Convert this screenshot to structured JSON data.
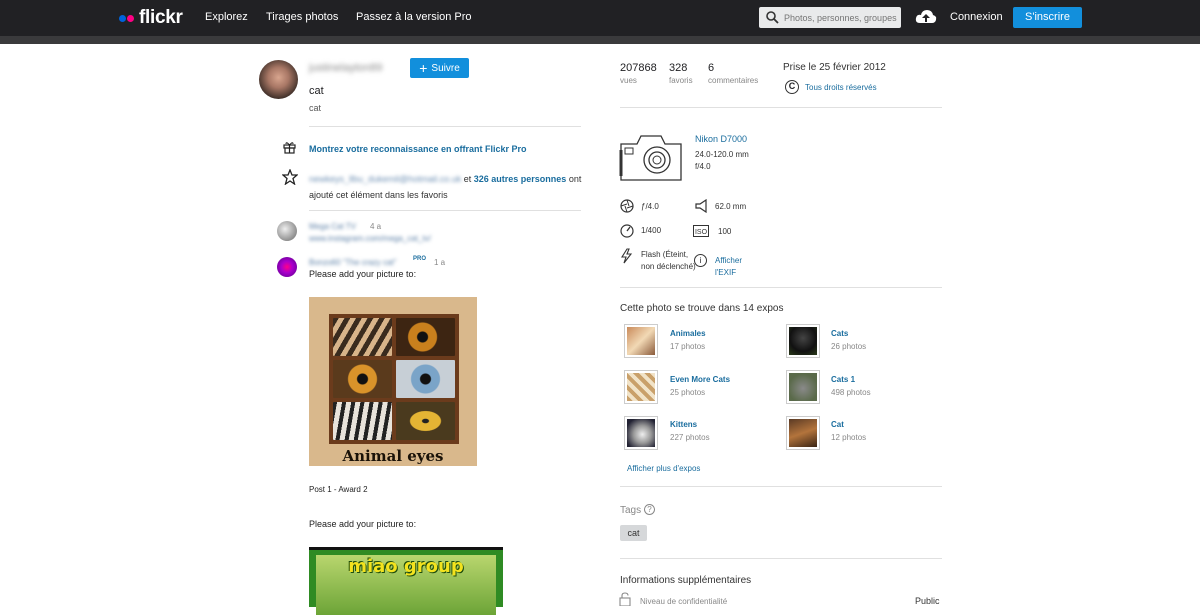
{
  "header": {
    "logo_text": "flickr",
    "nav": [
      "Explorez",
      "Tirages photos",
      "Passez à la version Pro"
    ],
    "search_placeholder": "Photos, personnes, groupes",
    "login": "Connexion",
    "signup": "S'inscrire"
  },
  "owner": {
    "name": "justinelayton89",
    "follow_label": "Suivre"
  },
  "photo": {
    "title": "cat",
    "description": "cat",
    "pro_message": "Montrez votre reconnaissance en offrant Flickr Pro",
    "faves": {
      "first_faver": "newkeys_llbu_dukemil@hotmail.co.uk",
      "connector": "et",
      "others_link": "326 autres personnes",
      "suffix": "ont ajouté cet élément dans les favoris"
    }
  },
  "comments": [
    {
      "author": "Mega Cat TV",
      "time": "4 a",
      "meta": "www.instagram.com/mega_cat_tv/"
    },
    {
      "author": "Bonzo60 \"The crazy cat\"",
      "badge": "PRO",
      "time": "1 a",
      "text": "Please add your picture to:",
      "image_caption": "Animal eyes",
      "post_label": "Post 1 - Award 2",
      "text2": "Please add your picture to:",
      "image2_caption": "miao group"
    }
  ],
  "stats": {
    "views": "207868",
    "views_label": "vues",
    "faves": "328",
    "faves_label": "favoris",
    "comments": "6",
    "comments_label": "commentaires",
    "taken": "Prise le 25 février 2012",
    "rights": "Tous droits réservés"
  },
  "camera": {
    "model": "Nikon D7000",
    "lens": "24.0-120.0 mm",
    "aperture_short": "f/4.0",
    "exif": {
      "aperture": "ƒ/4.0",
      "focal": "62.0 mm",
      "shutter": "1/400",
      "iso": "100",
      "flash": "Flash (Éteint, non déclenché)",
      "show_exif": "Afficher l'EXIF"
    }
  },
  "albums": {
    "title": "Cette photo se trouve dans 14 expos",
    "items": [
      {
        "name": "Animales",
        "count": "17 photos"
      },
      {
        "name": "Cats",
        "count": "26 photos"
      },
      {
        "name": "Even More Cats",
        "count": "25 photos"
      },
      {
        "name": "Cats 1",
        "count": "498 photos"
      },
      {
        "name": "Kittens",
        "count": "227 photos"
      },
      {
        "name": "Cat",
        "count": "12 photos"
      }
    ],
    "more": "Afficher plus d'expos"
  },
  "tags": {
    "title": "Tags",
    "items": [
      "cat"
    ]
  },
  "more_info": {
    "title": "Informations supplémentaires",
    "privacy_label": "Niveau de confidentialité",
    "privacy_value": "Public"
  },
  "colors": {
    "accent": "#128fdc",
    "link": "#1a6d9e",
    "topbar": "#212124"
  }
}
